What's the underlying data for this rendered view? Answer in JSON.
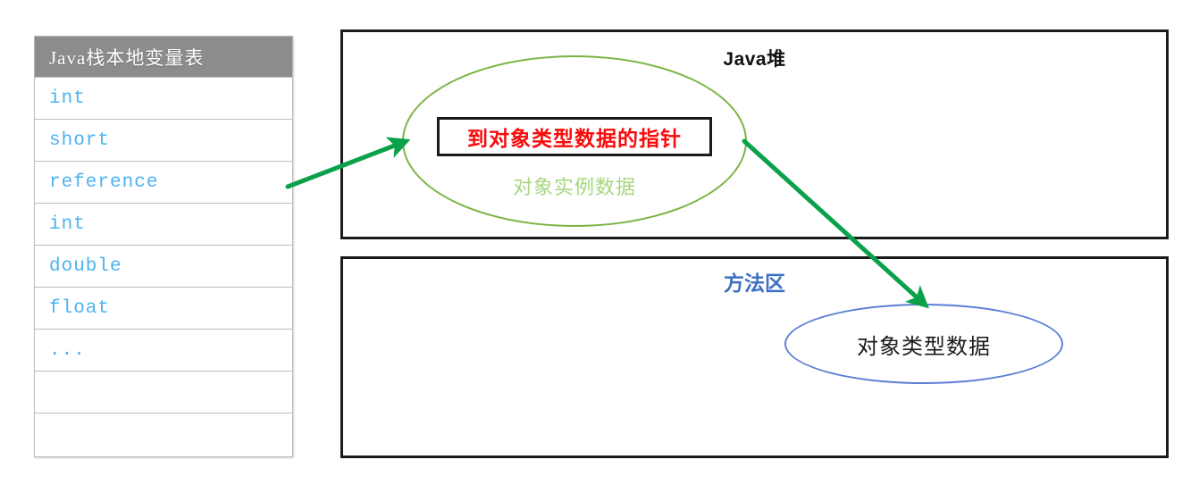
{
  "diagram": {
    "title": "Java object access via handle/direct pointer",
    "colors": {
      "stack_header_bg": "#8c8c8c",
      "stack_text": "#4db2f0",
      "region_border": "#1a1a1a",
      "instance_ellipse": "#7cb342",
      "instance_label": "#a7d67f",
      "pointer_text": "#fa0a0a",
      "method_area_title": "#3b6fc4",
      "type_ellipse": "#5b7fd4",
      "arrow": "#0aa14a"
    }
  },
  "stack_table": {
    "header": "Java栈本地变量表",
    "rows": [
      {
        "label": "int"
      },
      {
        "label": "short"
      },
      {
        "label": "reference"
      },
      {
        "label": "int"
      },
      {
        "label": "double"
      },
      {
        "label": "float"
      },
      {
        "label": "..."
      },
      {
        "label": ""
      },
      {
        "label": ""
      }
    ]
  },
  "java_heap": {
    "title": "Java堆",
    "instance_ellipse_label": "对象实例数据",
    "pointer_box_label": "到对象类型数据的指针"
  },
  "method_area": {
    "title": "方法区",
    "type_ellipse_label": "对象类型数据"
  },
  "arrows": [
    {
      "name": "reference-to-instance",
      "from": "reference row",
      "to": "object instance data ellipse"
    },
    {
      "name": "pointer-to-type-data",
      "from": "pointer box",
      "to": "object type data ellipse"
    }
  ]
}
